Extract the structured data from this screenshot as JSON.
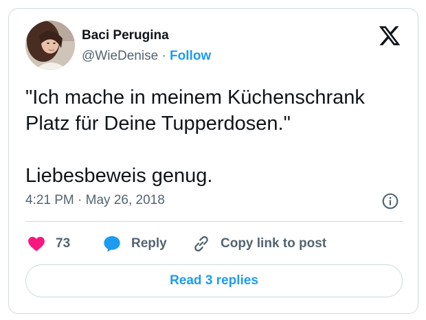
{
  "author": {
    "name": "Baci Perugina",
    "handle": "@WieDenise",
    "separator": "·",
    "follow_label": "Follow"
  },
  "tweet": {
    "lines": [
      "\"Ich mache in meinem Küchenschrank",
      "Platz für Deine Tupperdosen.\"",
      "Liebesbeweis genug."
    ],
    "time": "4:21 PM",
    "separator": "·",
    "date": "May 26, 2018"
  },
  "actions": {
    "like_count": "73",
    "reply_label": "Reply",
    "copy_label": "Copy link to post"
  },
  "read_replies_label": "Read 3 replies",
  "icons": {
    "logo": "x-logo-icon",
    "info": "info-icon",
    "like": "heart-icon",
    "reply": "speech-bubble-icon",
    "copy": "link-icon"
  },
  "colors": {
    "accent": "#1d9bf0",
    "like": "#f91880",
    "text": "#0f1419",
    "secondary": "#536471",
    "border": "#cfd9de"
  }
}
